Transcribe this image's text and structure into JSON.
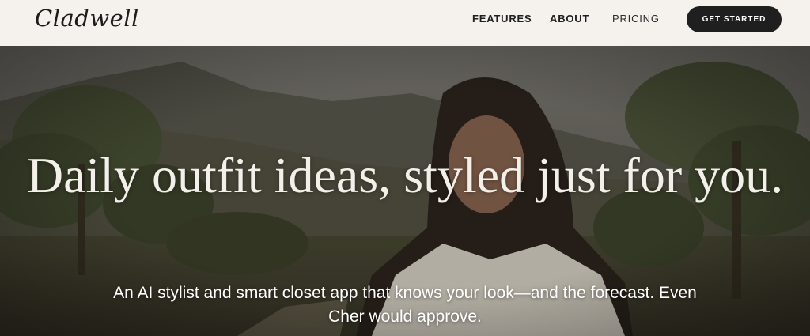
{
  "brand": {
    "logo_text": "Cladwell"
  },
  "nav": {
    "items": [
      {
        "label": "FEATURES"
      },
      {
        "label": "ABOUT"
      },
      {
        "label": "PRICING"
      }
    ],
    "cta_label": "GET STARTED"
  },
  "hero": {
    "headline": "Daily outfit ideas, styled just for you.",
    "subheadline": "An AI stylist and smart closet app that knows your look—and the forecast. Even Cher would approve."
  },
  "colors": {
    "nav_background": "#f5f1ec",
    "cta_background": "#1f1f1f",
    "hero_text": "#f3efe9"
  }
}
